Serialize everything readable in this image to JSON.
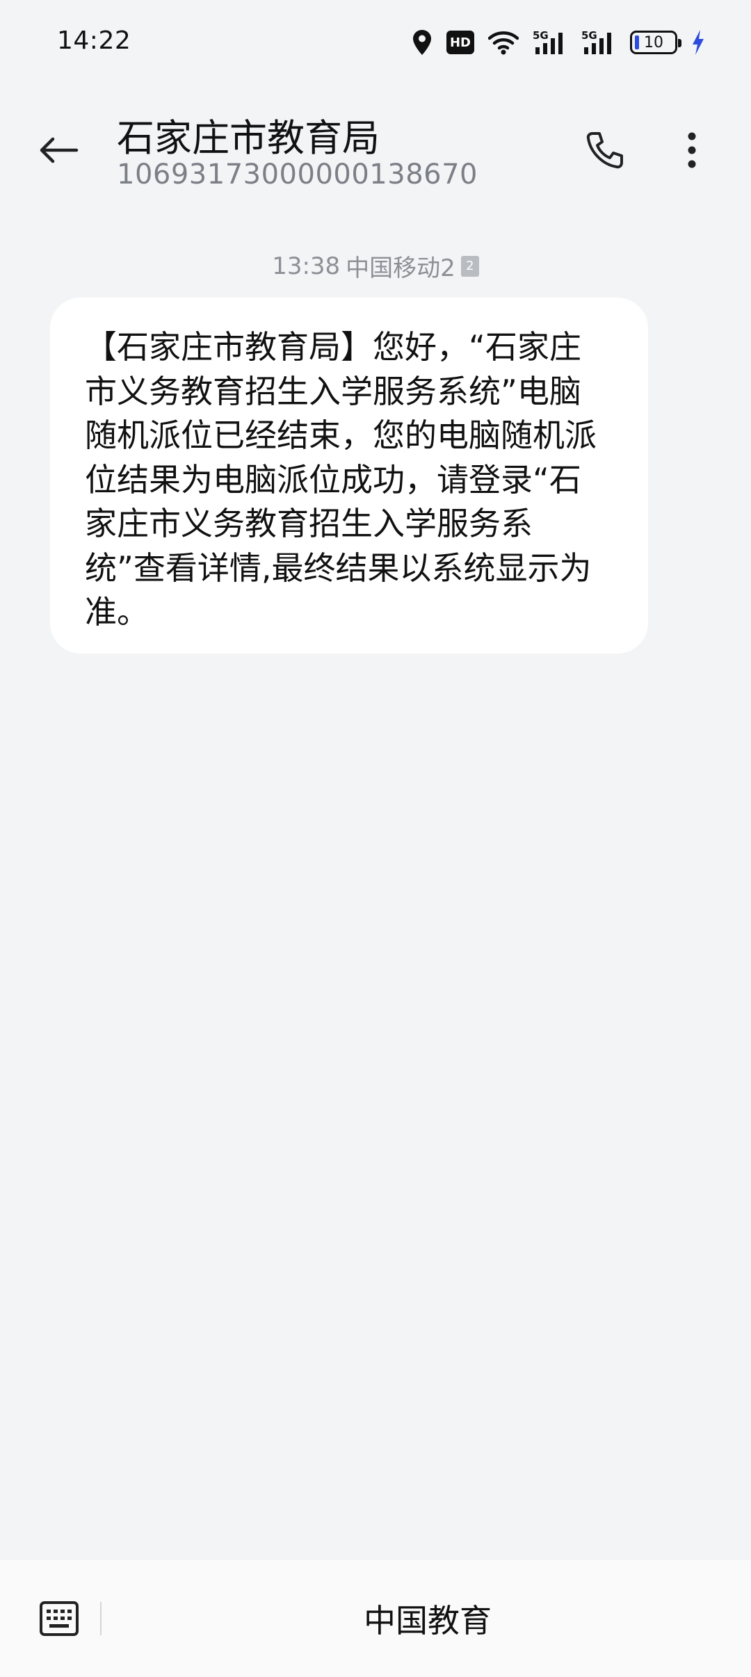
{
  "status_bar": {
    "time": "14:22",
    "icons": [
      "location-icon",
      "hd-icon",
      "wifi-icon",
      "signal-5g-1-icon",
      "signal-5g-2-icon",
      "battery-icon",
      "charging-icon"
    ],
    "hd_label": "HD",
    "battery_level": "10",
    "battery_fill_fraction": 0.1
  },
  "header": {
    "contact_name": "石家庄市教育局",
    "contact_number": "10693173000000138670",
    "icons": [
      "back-arrow-icon",
      "phone-icon",
      "more-vertical-icon"
    ]
  },
  "message": {
    "time": "13:38",
    "carrier": "中国移动2",
    "sim_badge": "2",
    "body": "【石家庄市教育局】您好，“石家庄市义务教育招生入学服务系统”电脑随机派位已经结束，您的电脑随机派位结果为电脑派位成功，请登录“石家庄市义务教育招生入学服务系统”查看详情,最终结果以系统显示为准。"
  },
  "bottom_bar": {
    "keyboard_icon": "keyboard-icon",
    "menu_label": "中国教育"
  },
  "colors": {
    "background": "#f3f4f6",
    "bubble": "#ffffff",
    "secondary_text": "#7b7f86",
    "charging": "#2b4bdc"
  }
}
